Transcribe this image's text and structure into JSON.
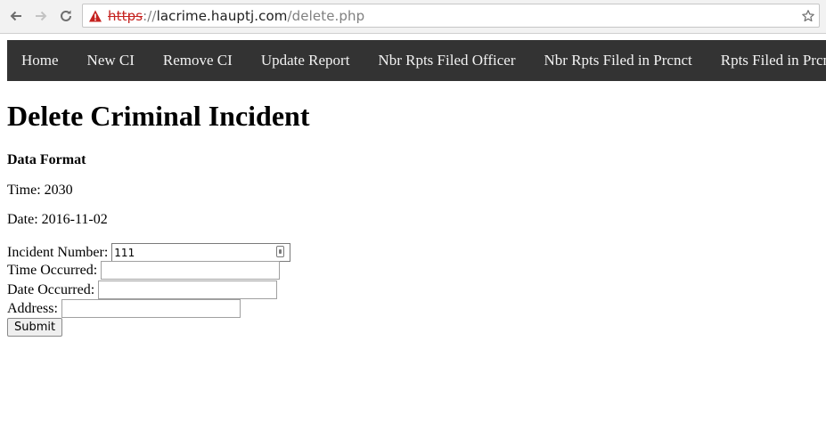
{
  "browser": {
    "url_scheme": "https",
    "url_separator": "://",
    "url_host": "lacrime.hauptj.com",
    "url_path": "/delete.php",
    "icons": [
      "back-icon",
      "forward-icon",
      "reload-icon",
      "not-secure-warning-icon",
      "bookmark-star-icon"
    ]
  },
  "nav": {
    "items": [
      {
        "label": "Home"
      },
      {
        "label": "New CI"
      },
      {
        "label": "Remove CI"
      },
      {
        "label": "Update Report"
      },
      {
        "label": "Nbr Rpts Filed Officer"
      },
      {
        "label": "Nbr Rpts Filed in Prcnct"
      },
      {
        "label": "Rpts Filed in Prcnct"
      }
    ],
    "background": "#333333",
    "text_color": "#f2f2f2"
  },
  "page": {
    "title": "Delete Criminal Incident",
    "format_heading": "Data Format",
    "time_format": "Time: 2030",
    "date_format": "Date: 2016-11-02"
  },
  "form": {
    "incident_number": {
      "label": "Incident Number:",
      "value": "111"
    },
    "time_occurred": {
      "label": "Time Occurred:",
      "value": ""
    },
    "date_occurred": {
      "label": "Date Occurred:",
      "value": ""
    },
    "address": {
      "label": "Address:",
      "value": ""
    },
    "submit_label": "Submit"
  }
}
